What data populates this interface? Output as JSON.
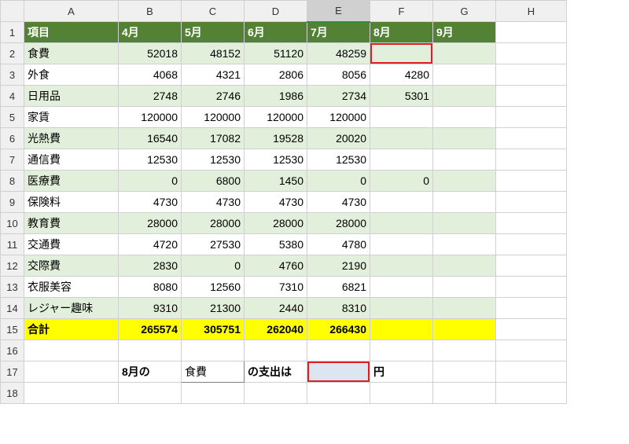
{
  "columns": [
    "A",
    "B",
    "C",
    "D",
    "E",
    "F",
    "G",
    "H"
  ],
  "headers": {
    "A": "項目",
    "B": "4月",
    "C": "5月",
    "D": "6月",
    "E": "7月",
    "F": "8月",
    "G": "9月"
  },
  "rows": [
    {
      "label": "食費",
      "v": [
        "52018",
        "48152",
        "51120",
        "48259",
        "",
        ""
      ]
    },
    {
      "label": "外食",
      "v": [
        "4068",
        "4321",
        "2806",
        "8056",
        "4280",
        ""
      ]
    },
    {
      "label": "日用品",
      "v": [
        "2748",
        "2746",
        "1986",
        "2734",
        "5301",
        ""
      ]
    },
    {
      "label": "家賃",
      "v": [
        "120000",
        "120000",
        "120000",
        "120000",
        "",
        ""
      ]
    },
    {
      "label": "光熱費",
      "v": [
        "16540",
        "17082",
        "19528",
        "20020",
        "",
        ""
      ]
    },
    {
      "label": "通信費",
      "v": [
        "12530",
        "12530",
        "12530",
        "12530",
        "",
        ""
      ]
    },
    {
      "label": "医療費",
      "v": [
        "0",
        "6800",
        "1450",
        "0",
        "0",
        ""
      ]
    },
    {
      "label": "保険料",
      "v": [
        "4730",
        "4730",
        "4730",
        "4730",
        "",
        ""
      ]
    },
    {
      "label": "教育費",
      "v": [
        "28000",
        "28000",
        "28000",
        "28000",
        "",
        ""
      ]
    },
    {
      "label": "交通費",
      "v": [
        "4720",
        "27530",
        "5380",
        "4780",
        "",
        ""
      ]
    },
    {
      "label": "交際費",
      "v": [
        "2830",
        "0",
        "4760",
        "2190",
        "",
        ""
      ]
    },
    {
      "label": "衣服美容",
      "v": [
        "8080",
        "12560",
        "7310",
        "6821",
        "",
        ""
      ]
    },
    {
      "label": "レジャー趣味",
      "v": [
        "9310",
        "21300",
        "2440",
        "8310",
        "",
        ""
      ]
    }
  ],
  "total": {
    "label": "合計",
    "v": [
      "265574",
      "305751",
      "262040",
      "266430",
      "",
      ""
    ]
  },
  "line17": {
    "B": "8月の",
    "C": "食費",
    "D": "の支出は",
    "E": "",
    "F": "円"
  },
  "chart_data": {
    "type": "table",
    "title": "月別支出",
    "categories": [
      "4月",
      "5月",
      "6月",
      "7月",
      "8月",
      "9月"
    ],
    "series": [
      {
        "name": "食費",
        "values": [
          52018,
          48152,
          51120,
          48259,
          null,
          null
        ]
      },
      {
        "name": "外食",
        "values": [
          4068,
          4321,
          2806,
          8056,
          4280,
          null
        ]
      },
      {
        "name": "日用品",
        "values": [
          2748,
          2746,
          1986,
          2734,
          5301,
          null
        ]
      },
      {
        "name": "家賃",
        "values": [
          120000,
          120000,
          120000,
          120000,
          null,
          null
        ]
      },
      {
        "name": "光熱費",
        "values": [
          16540,
          17082,
          19528,
          20020,
          null,
          null
        ]
      },
      {
        "name": "通信費",
        "values": [
          12530,
          12530,
          12530,
          12530,
          null,
          null
        ]
      },
      {
        "name": "医療費",
        "values": [
          0,
          6800,
          1450,
          0,
          0,
          null
        ]
      },
      {
        "name": "保険料",
        "values": [
          4730,
          4730,
          4730,
          4730,
          null,
          null
        ]
      },
      {
        "name": "教育費",
        "values": [
          28000,
          28000,
          28000,
          28000,
          null,
          null
        ]
      },
      {
        "name": "交通費",
        "values": [
          4720,
          27530,
          5380,
          4780,
          null,
          null
        ]
      },
      {
        "name": "交際費",
        "values": [
          2830,
          0,
          4760,
          2190,
          null,
          null
        ]
      },
      {
        "name": "衣服美容",
        "values": [
          8080,
          12560,
          7310,
          6821,
          null,
          null
        ]
      },
      {
        "name": "レジャー趣味",
        "values": [
          9310,
          21300,
          2440,
          8310,
          null,
          null
        ]
      },
      {
        "name": "合計",
        "values": [
          265574,
          305751,
          262040,
          266430,
          null,
          null
        ]
      }
    ]
  }
}
